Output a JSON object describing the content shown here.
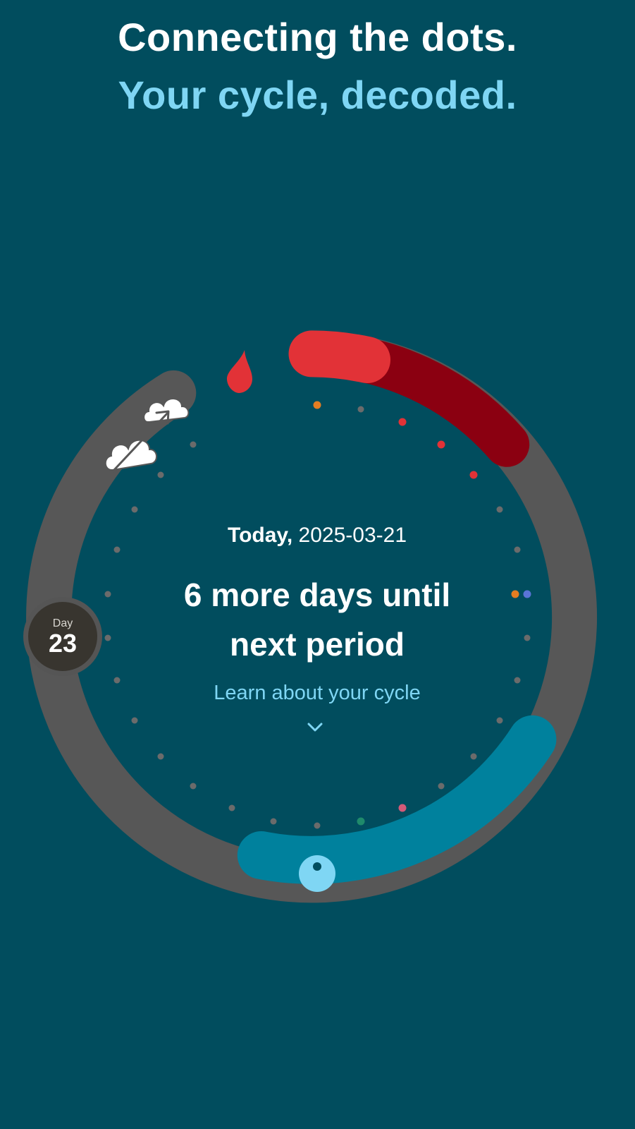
{
  "header": {
    "title": "Connecting the dots.",
    "subtitle": "Your cycle, decoded."
  },
  "center": {
    "today_label": "Today,",
    "today_date": "2025-03-21",
    "days_until_line1": "6 more days until",
    "days_until_line2": "next period",
    "learn_link": "Learn about your cycle"
  },
  "day_badge": {
    "caption": "Day",
    "number": "23"
  },
  "icons": {
    "period_drop": "blood-drop-icon",
    "ovulation": "ovulation-egg-icon",
    "clouds": "clouds-arrow-icon",
    "expand": "chevron-down-icon"
  },
  "colors": {
    "background": "#014d5e",
    "period_light": "#e23237",
    "period_dark": "#8b0011",
    "ring_neutral": "#575757",
    "fertile": "#00819d",
    "ovulation": "#7fd6f4",
    "accent_text": "#7fd6f4"
  }
}
